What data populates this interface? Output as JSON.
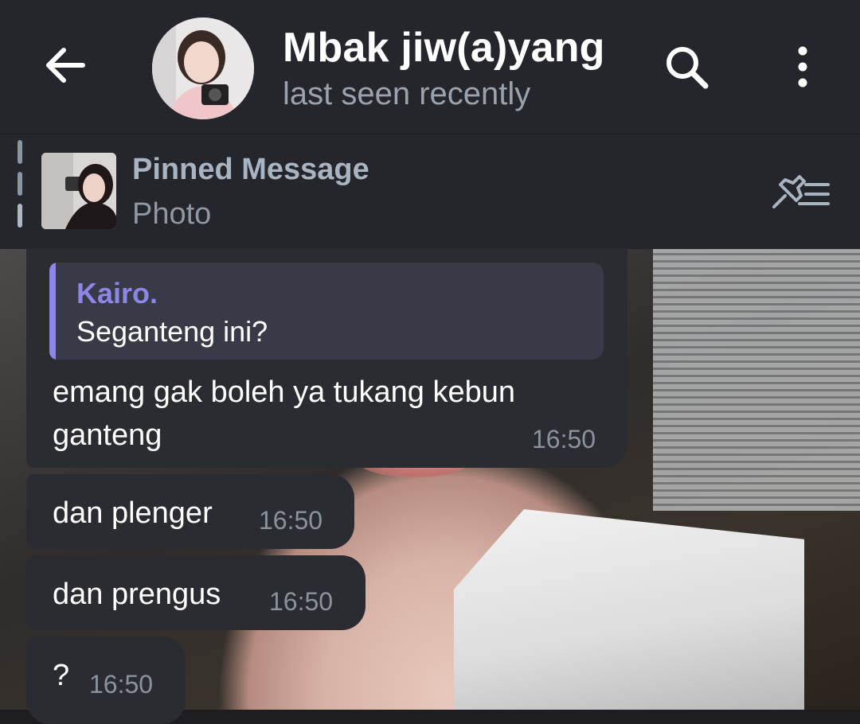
{
  "header": {
    "title": "Mbak jiw(a)yang",
    "status": "last seen recently"
  },
  "icons": {
    "back": "arrow-left-icon",
    "search": "search-icon",
    "menu": "more-vertical-icon",
    "pin_list": "pin-list-icon"
  },
  "pinned": {
    "title": "Pinned Message",
    "subtitle": "Photo"
  },
  "messages": [
    {
      "reply": {
        "name": "Kairo.",
        "text": "Seganteng ini?"
      },
      "text": "emang gak boleh ya tukang kebun ganteng",
      "time": "16:50"
    },
    {
      "text": "dan plenger",
      "time": "16:50"
    },
    {
      "text": "dan prengus",
      "time": "16:50"
    },
    {
      "text": "?",
      "time": "16:50"
    }
  ],
  "colors": {
    "header_bg": "#24262b",
    "bubble_bg": "#2b2c31",
    "reply_accent": "#8c87e6",
    "secondary_text": "#9aa3ad"
  }
}
